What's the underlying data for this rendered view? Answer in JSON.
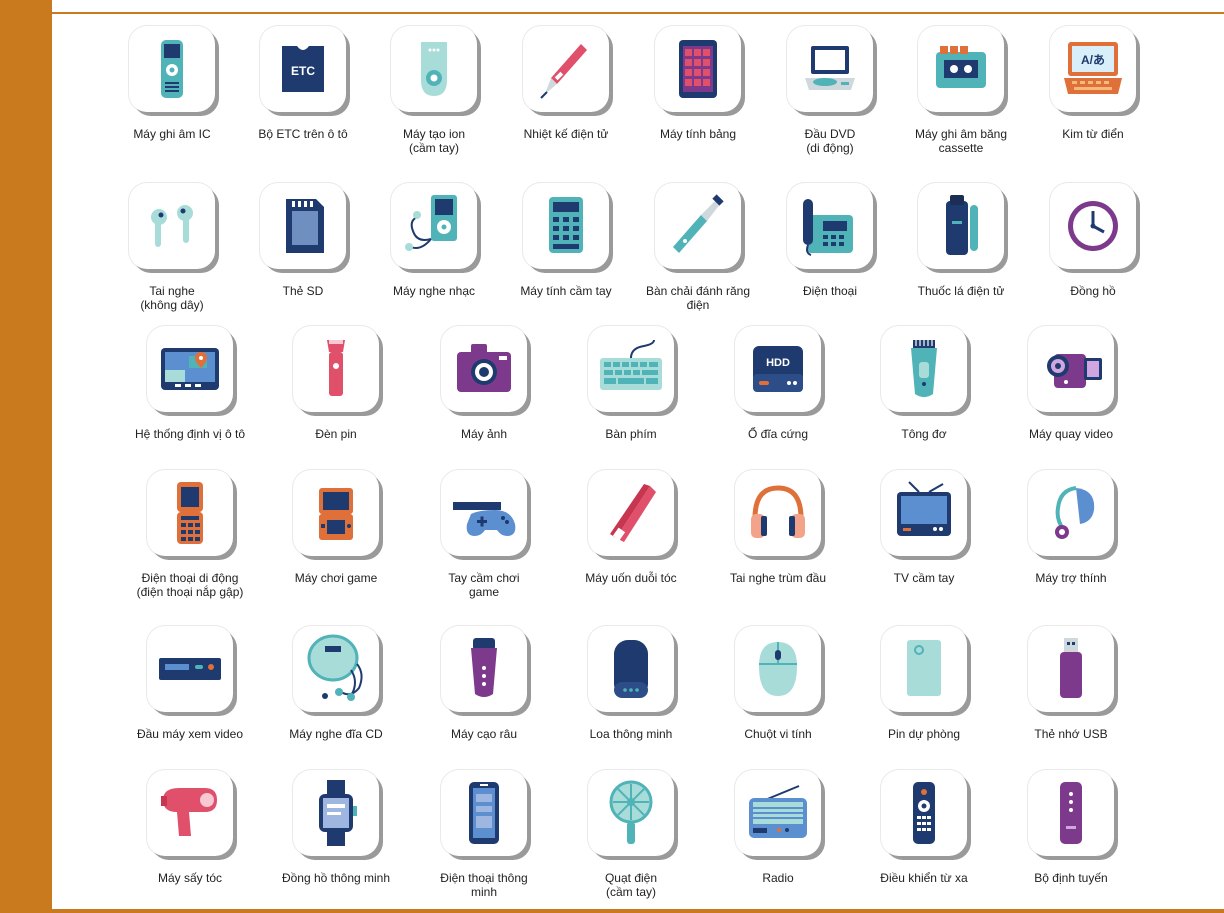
{
  "rows": [
    [
      "Máy ghi âm IC",
      "Bộ ETC trên ô tô",
      "Máy tạo ion\n(cầm tay)",
      "Nhiệt kế điện tử",
      "Máy tính bảng",
      "Đầu DVD\n(di động)",
      "Máy ghi âm băng\ncassette",
      "Kim từ điển"
    ],
    [
      "Tai nghe\n(không dây)",
      "Thẻ SD",
      "Máy nghe nhạc",
      "Máy tính cầm tay",
      "Bàn chải đánh răng\nđiện",
      "Điện thoại",
      "Thuốc lá điện tử",
      "Đồng hồ"
    ],
    [
      "Hệ thống định vị ô tô",
      "Đèn pin",
      "Máy ảnh",
      "Bàn phím",
      "Ổ đĩa cứng",
      "Tông đơ",
      "Máy quay video"
    ],
    [
      "Điện thoại di động\n(điện thoại nắp gập)",
      "Máy chơi game",
      "Tay cầm chơi\ngame",
      "Máy uốn duỗi tóc",
      "Tai nghe trùm đầu",
      "TV cầm tay",
      "Máy trợ thính"
    ],
    [
      "Đầu máy xem video",
      "Máy nghe đĩa CD",
      "Máy cạo râu",
      "Loa thông minh",
      "Chuột vi tính",
      "Pin dự phòng",
      "Thẻ nhớ USB"
    ],
    [
      "Máy sấy tóc",
      "Đồng hồ thông minh",
      "Điện thoại thông\nminh",
      "Quạt điện\n(cầm tay)",
      "Radio",
      "Điều khiển từ xa",
      "Bộ định tuyến"
    ]
  ],
  "icons": [
    [
      "ic-recorder-icon",
      "etc-card-icon",
      "ion-generator-icon",
      "thermometer-icon",
      "tablet-icon",
      "dvd-player-icon",
      "cassette-recorder-icon",
      "electronic-dictionary-icon"
    ],
    [
      "wireless-earbuds-icon",
      "sd-card-icon",
      "music-player-icon",
      "calculator-icon",
      "electric-toothbrush-icon",
      "telephone-icon",
      "e-cigarette-icon",
      "clock-icon"
    ],
    [
      "car-navigation-icon",
      "flashlight-icon",
      "camera-icon",
      "keyboard-icon",
      "hard-drive-icon",
      "hair-clipper-icon",
      "video-camera-icon"
    ],
    [
      "flip-phone-icon",
      "game-console-icon",
      "game-controller-icon",
      "hair-straightener-icon",
      "headphones-icon",
      "portable-tv-icon",
      "hearing-aid-icon"
    ],
    [
      "video-player-icon",
      "cd-player-icon",
      "shaver-icon",
      "smart-speaker-icon",
      "computer-mouse-icon",
      "power-bank-icon",
      "usb-drive-icon"
    ],
    [
      "hair-dryer-icon",
      "smartwatch-icon",
      "smartphone-icon",
      "handheld-fan-icon",
      "radio-icon",
      "remote-control-icon",
      "router-icon"
    ]
  ],
  "icon_text": {
    "etc": "ETC",
    "dictionary": "A/あ",
    "hdd": "HDD"
  },
  "colors": {
    "accent": "#c97a1e",
    "navy": "#1e3a6e",
    "teal": "#4fb3b8",
    "purple": "#7d3a8c",
    "pink": "#e0506a",
    "orange": "#e0703a"
  }
}
